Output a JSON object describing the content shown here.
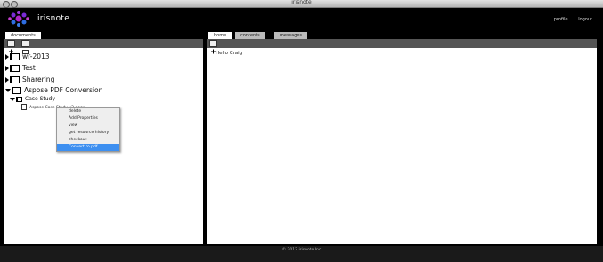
{
  "window": {
    "title": "irisnote"
  },
  "app": {
    "name": "irisnote",
    "links": [
      "profile",
      "logout"
    ]
  },
  "left_panel": {
    "tab": "documents",
    "tree": [
      {
        "label": "wr-2013"
      },
      {
        "label": "Test"
      },
      {
        "label": "Sharering"
      },
      {
        "label": "Aspose PDF Conversion"
      },
      {
        "label": "Case Study"
      },
      {
        "label": "Aspose Case Study v2.docx"
      }
    ],
    "context_menu": [
      "delete",
      "Add Properties",
      "view",
      "get resource history",
      "checkout",
      "Convert to pdf"
    ]
  },
  "right_panel": {
    "tabs": [
      "home",
      "contents",
      "messages"
    ],
    "greeting": "Hello Craig"
  },
  "footer": {
    "text": "© 2012 irisnote Inc"
  },
  "colors": {
    "selected_menu": "#3d8ff0",
    "toolbar": "#555555"
  }
}
